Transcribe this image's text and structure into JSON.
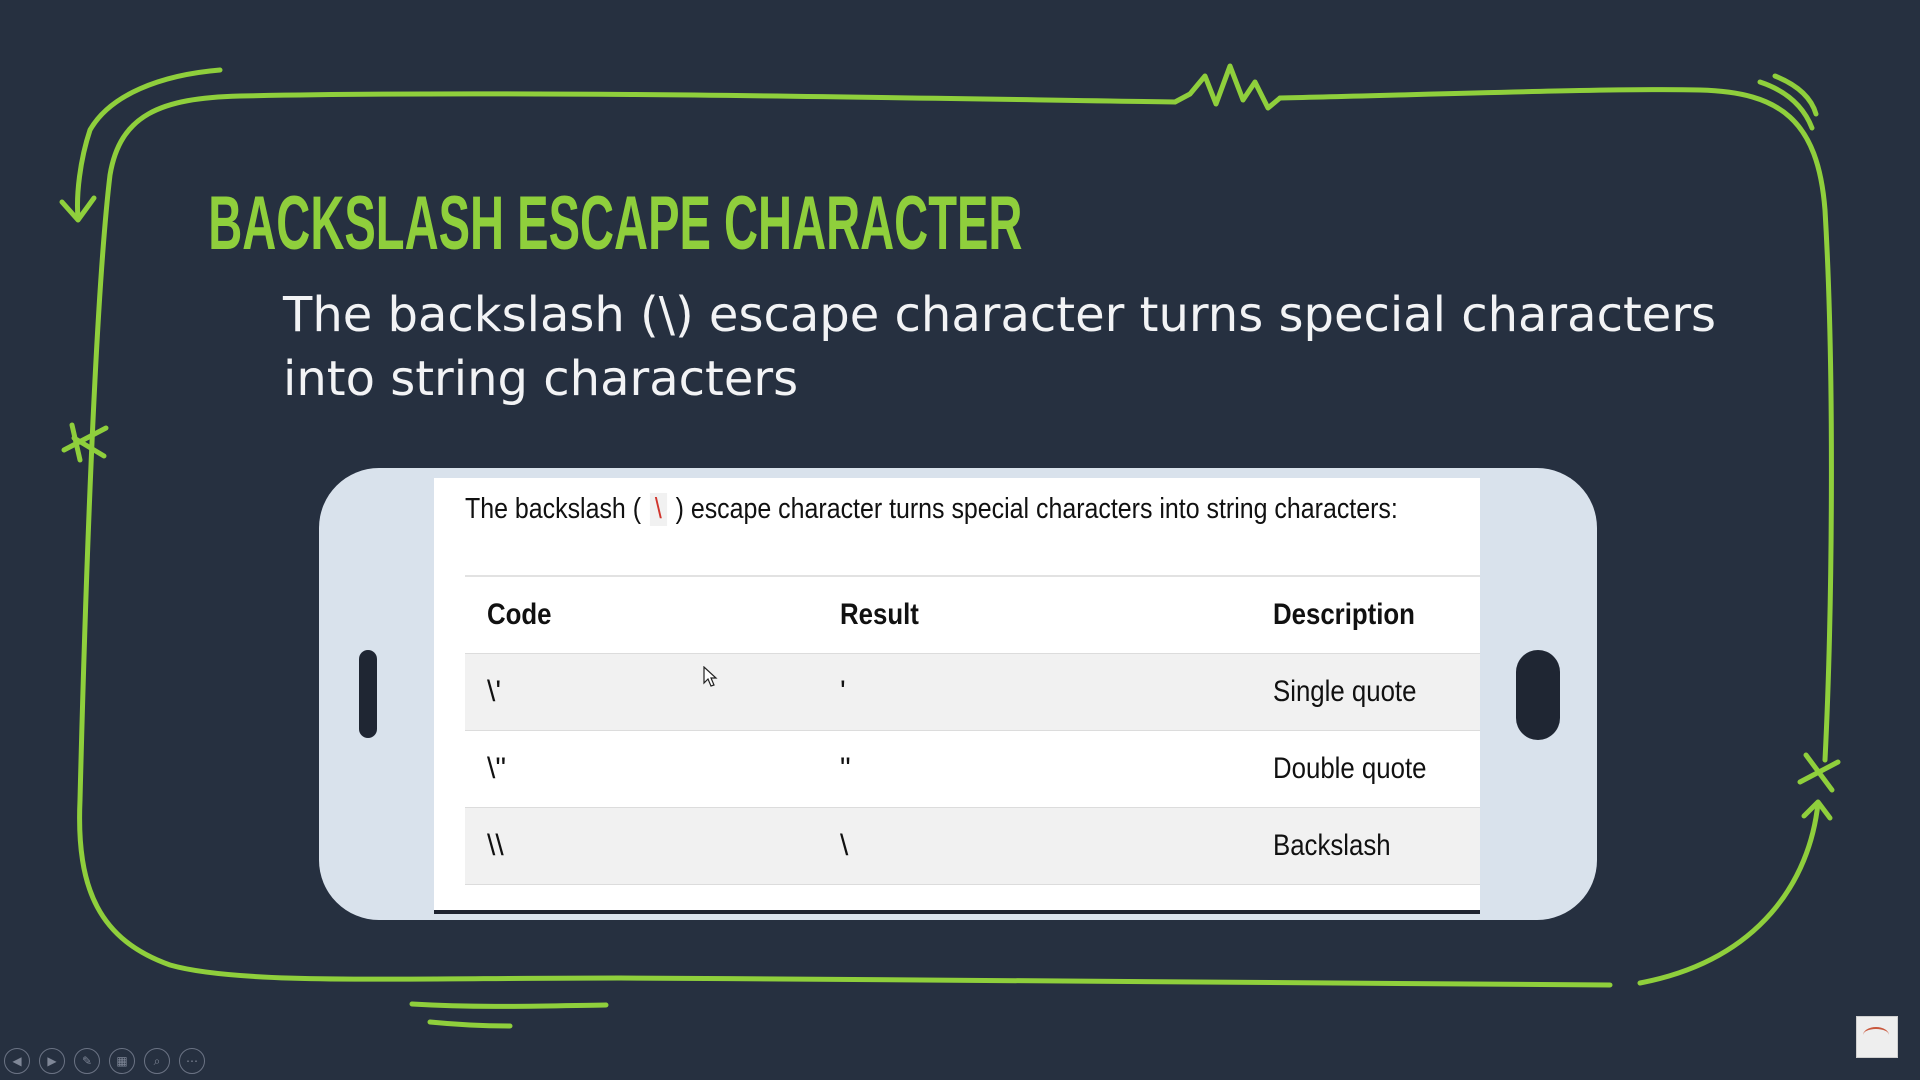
{
  "slide": {
    "title": "BACKSLASH ESCAPE CHARACTER",
    "body": "The backslash (\\) escape character turns special characters into string characters"
  },
  "screenshot": {
    "intro_before": "The backslash ( ",
    "intro_code": "\\",
    "intro_after": " ) escape character turns special characters into string characters:",
    "table": {
      "headers": [
        "Code",
        "Result",
        "Description"
      ],
      "rows": [
        {
          "code": "\\'",
          "result": "'",
          "description": "Single quote"
        },
        {
          "code": "\\\"",
          "result": "\"",
          "description": "Double quote"
        },
        {
          "code": "\\\\",
          "result": "\\",
          "description": "Backslash"
        }
      ]
    }
  },
  "colors": {
    "background": "#263040",
    "accent": "#8fcf3c",
    "body_text": "#f2f3f5",
    "phone": "#d9e2ec",
    "code_highlight": "#d0342c"
  },
  "icons": {
    "cursor": "mouse-pointer-icon",
    "toolbar": [
      "previous-icon",
      "next-icon",
      "pen-icon",
      "slides-grid-icon",
      "zoom-icon",
      "more-icon"
    ],
    "logo": "presenter-logo-icon"
  }
}
